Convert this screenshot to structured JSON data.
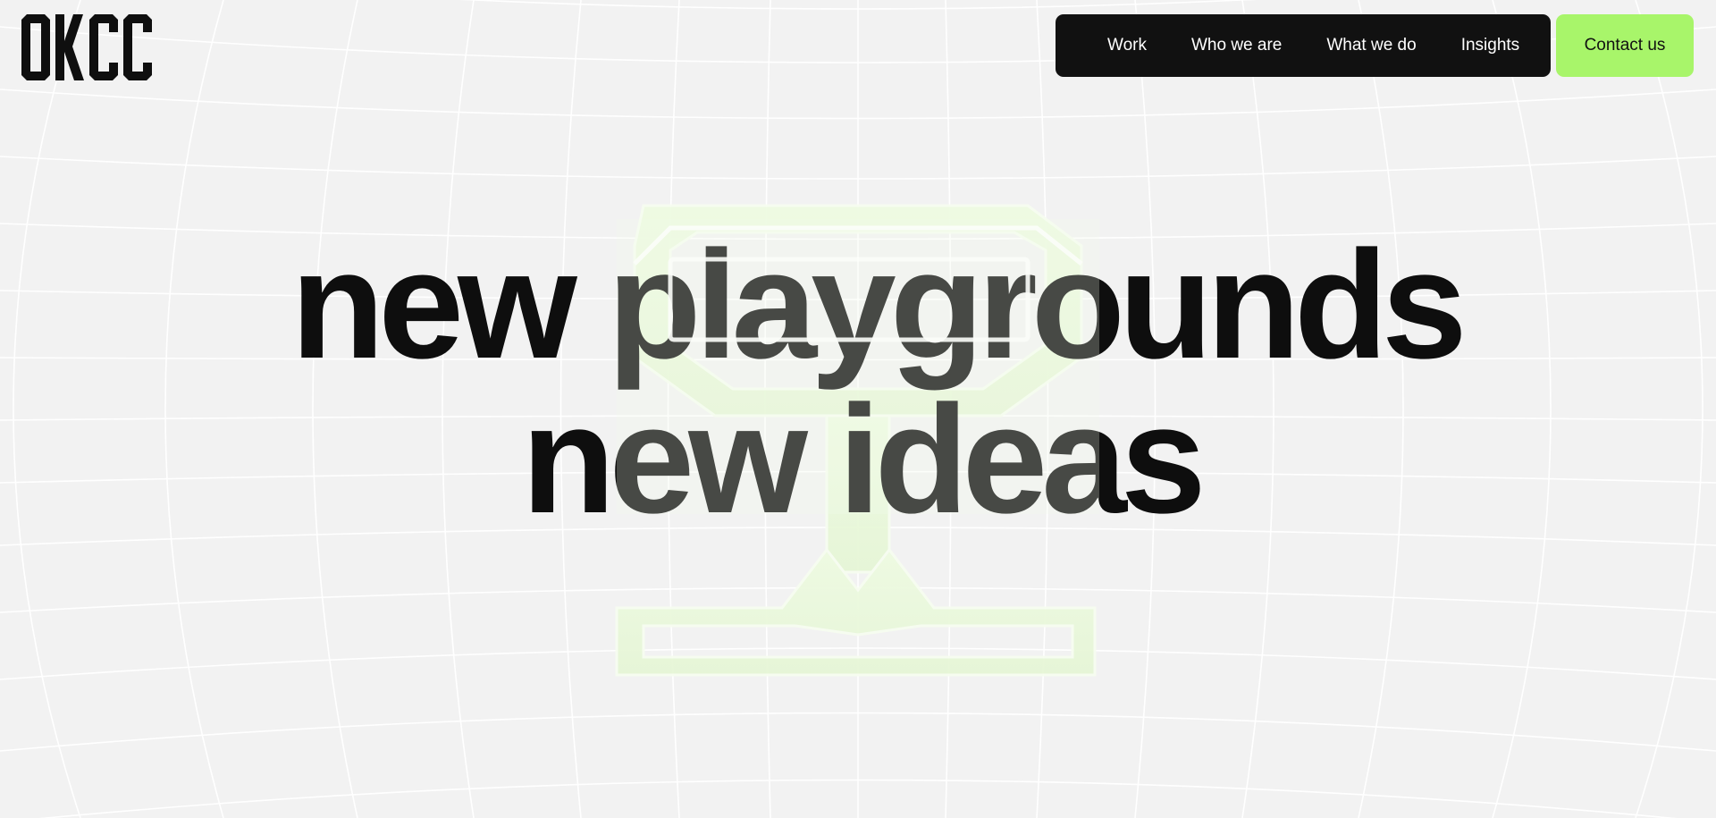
{
  "brand": {
    "logo_text": "OKCC"
  },
  "nav": {
    "items": [
      {
        "label": "Work"
      },
      {
        "label": "Who we are"
      },
      {
        "label": "What we do"
      },
      {
        "label": "Insights"
      }
    ],
    "contact_label": "Contact us"
  },
  "hero": {
    "line1": "new playgrounds",
    "line2": "new ideas"
  },
  "colors": {
    "background": "#f2f2f2",
    "grid_lines": "#ffffff",
    "nav_background": "#111111",
    "accent": "#a8f56a",
    "text": "#0e0e0e",
    "hero_shape": "#eaf8dc"
  },
  "icons": {
    "logo": "okcc-wordmark",
    "hero": "glass-trophy-shape"
  }
}
